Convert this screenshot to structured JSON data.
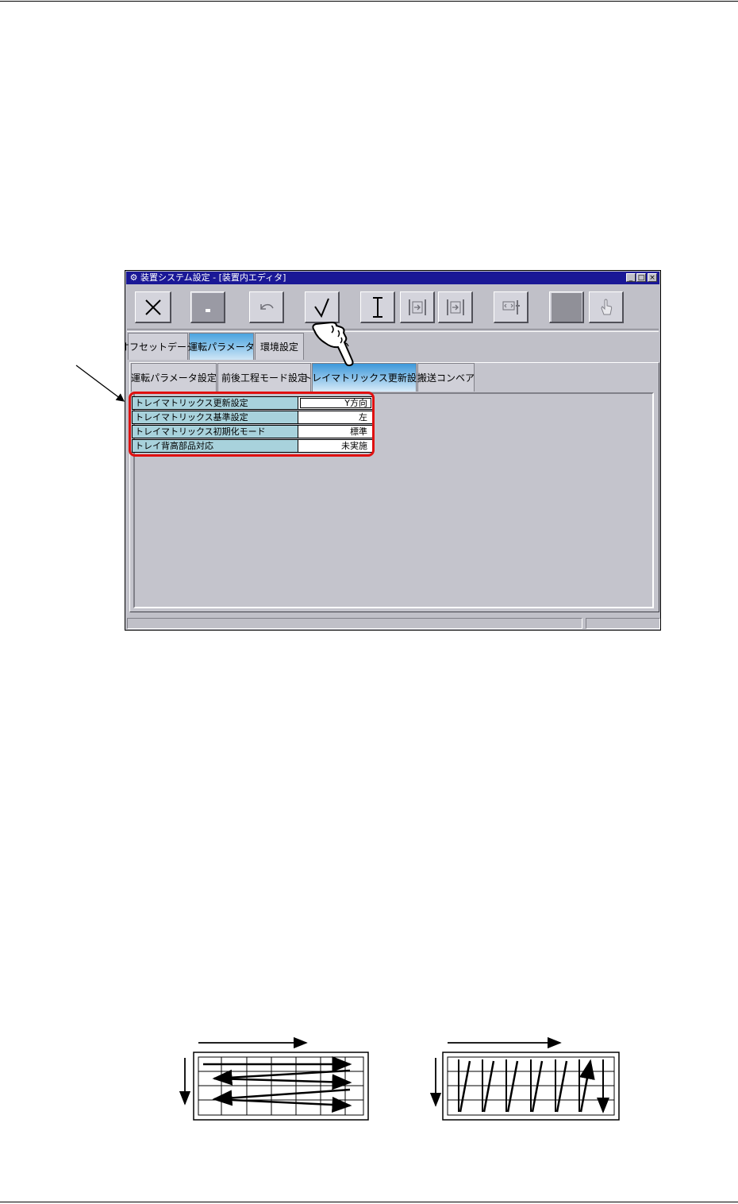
{
  "window": {
    "title": "装置システム設定 - [装置内エディタ]",
    "controls": {
      "minimize": "_",
      "maximize": "□",
      "close": "×"
    }
  },
  "toolbar": {
    "buttons": [
      {
        "name": "close",
        "icon": "x-icon"
      },
      {
        "name": "save",
        "icon": "floppy-icon"
      },
      {
        "name": "undo",
        "icon": "undo-arrow-icon"
      },
      {
        "name": "confirm",
        "icon": "check-icon"
      },
      {
        "name": "cursor",
        "icon": "text-cursor-icon"
      },
      {
        "name": "forward",
        "icon": "arrow-bar-icon"
      },
      {
        "name": "step",
        "icon": "arrow-bar-step-icon"
      },
      {
        "name": "transfer",
        "icon": "transfer-icon"
      },
      {
        "name": "stop",
        "icon": "blank-square-icon"
      },
      {
        "name": "hand",
        "icon": "hand-icon"
      }
    ]
  },
  "tabs": [
    {
      "label": "オフセットデータ",
      "active": false
    },
    {
      "label": "運転パラメータ",
      "active": true
    },
    {
      "label": "環境設定",
      "active": false
    }
  ],
  "subtabs": [
    {
      "label": "運転パラメータ設定",
      "active": false
    },
    {
      "label": "前後工程モード設定",
      "active": false
    },
    {
      "label": "トレイマトリックス更新設定",
      "active": true
    },
    {
      "label": "搬送コンベア",
      "active": false
    }
  ],
  "settings": [
    {
      "label": "トレイマトリックス更新設定",
      "value": "Y方向"
    },
    {
      "label": "トレイマトリックス基準設定",
      "value": "左"
    },
    {
      "label": "トレイマトリックス初期化モード",
      "value": "標準"
    },
    {
      "label": "トレイ背高部品対応",
      "value": "未実施"
    }
  ],
  "colors": {
    "titlebar": "#1a1896",
    "active_tab": "#4aa4e0",
    "grid_label_bg": "#a8d2dc",
    "highlight": "#e01010"
  },
  "diagrams": [
    {
      "name": "x-direction-update",
      "icon": "x-direction-grid-icon"
    },
    {
      "name": "y-direction-update",
      "icon": "y-direction-grid-icon"
    }
  ]
}
